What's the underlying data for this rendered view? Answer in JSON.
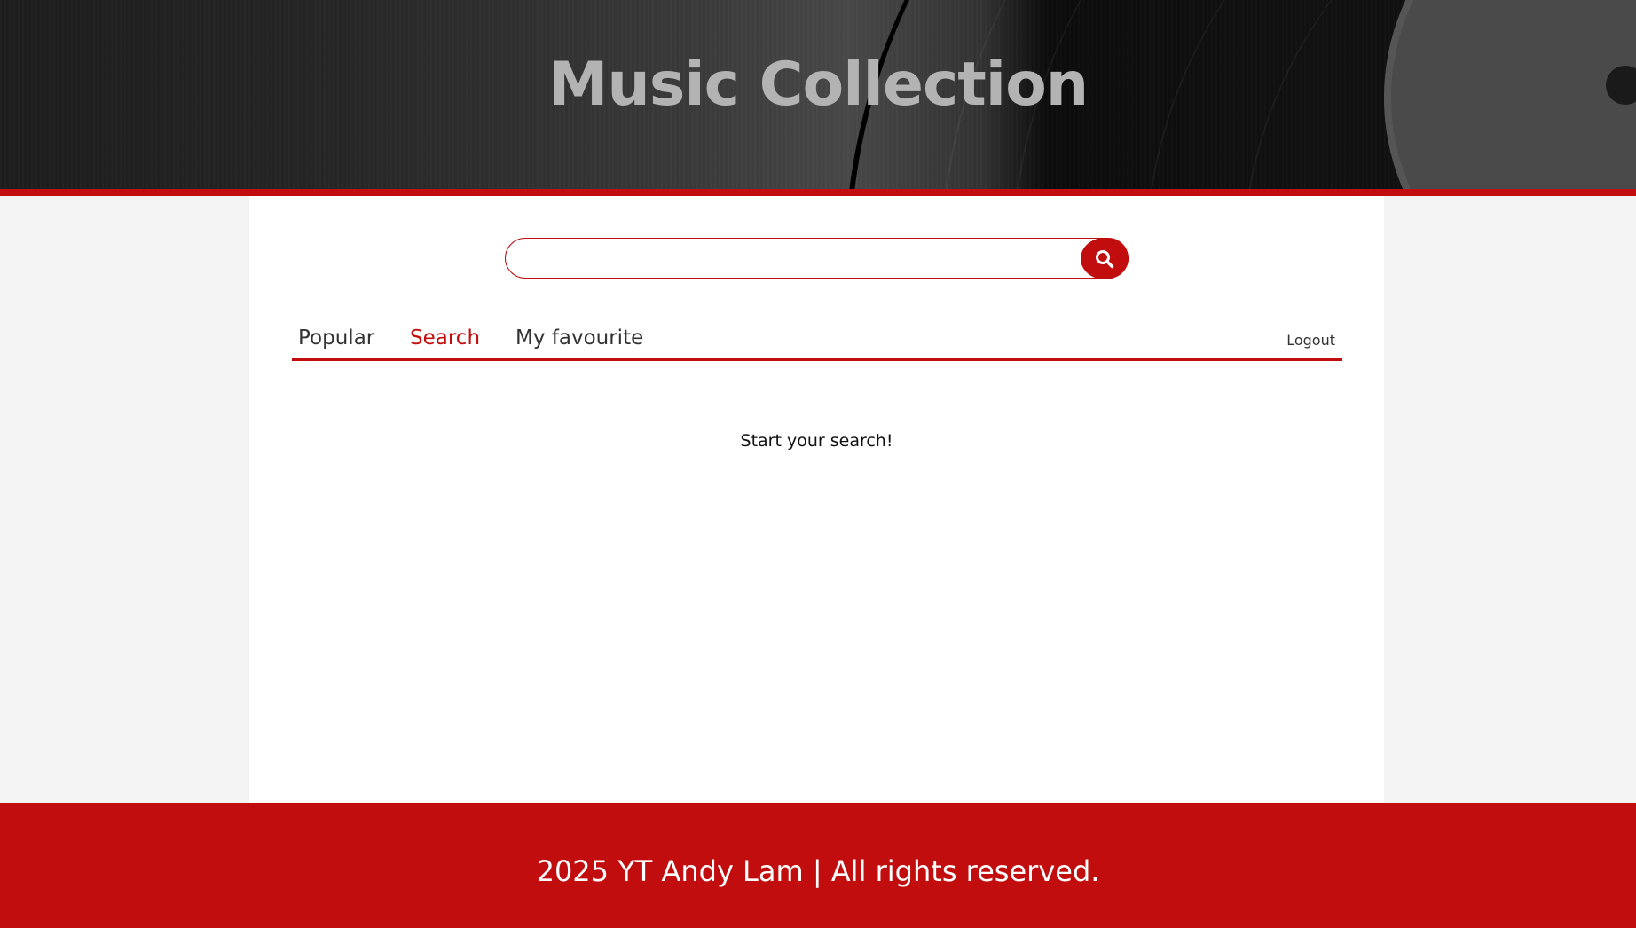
{
  "header": {
    "title": "Music Collection"
  },
  "search": {
    "placeholder": "",
    "value": "",
    "button_icon": "search-icon"
  },
  "tabs": [
    {
      "label": "Popular",
      "active": false
    },
    {
      "label": "Search",
      "active": true
    },
    {
      "label": "My favourite",
      "active": false
    }
  ],
  "nav": {
    "logout_label": "Logout"
  },
  "main": {
    "message": "Start your search!"
  },
  "footer": {
    "text": "2025 YT Andy Lam | All rights reserved."
  },
  "colors": {
    "accent": "#c10d0d",
    "background": "#f4f4f4",
    "panel": "#ffffff",
    "title": "#b3b3b3"
  }
}
